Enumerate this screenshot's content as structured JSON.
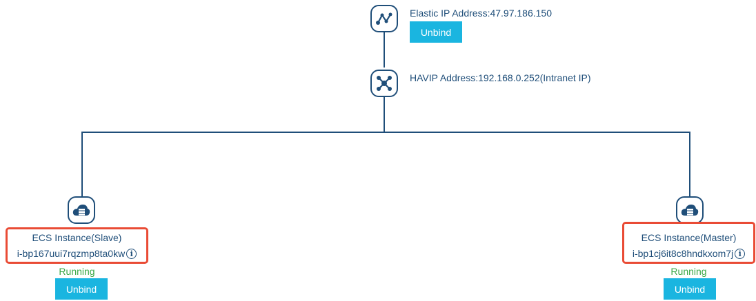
{
  "eip": {
    "label": "Elastic IP Address:47.97.186.150",
    "unbind_label": "Unbind",
    "icon": "eip-route-icon"
  },
  "havip": {
    "label": "HAVIP Address:192.168.0.252(Intranet IP)",
    "icon": "network-hub-icon"
  },
  "instances": [
    {
      "role": "ECS Instance(Slave)",
      "id": "i-bp167uui7rqzmp8ta0kw",
      "status": "Running",
      "unbind_label": "Unbind",
      "icon": "cloud-server-icon"
    },
    {
      "role": "ECS Instance(Master)",
      "id": "i-bp1cj6it8c8hndkxom7j",
      "status": "Running",
      "unbind_label": "Unbind",
      "icon": "cloud-server-icon"
    }
  ],
  "colors": {
    "primary_text": "#1f4e79",
    "button_bg": "#1ab5e0",
    "status_running": "#3aa845",
    "highlight": "#e94b35"
  }
}
